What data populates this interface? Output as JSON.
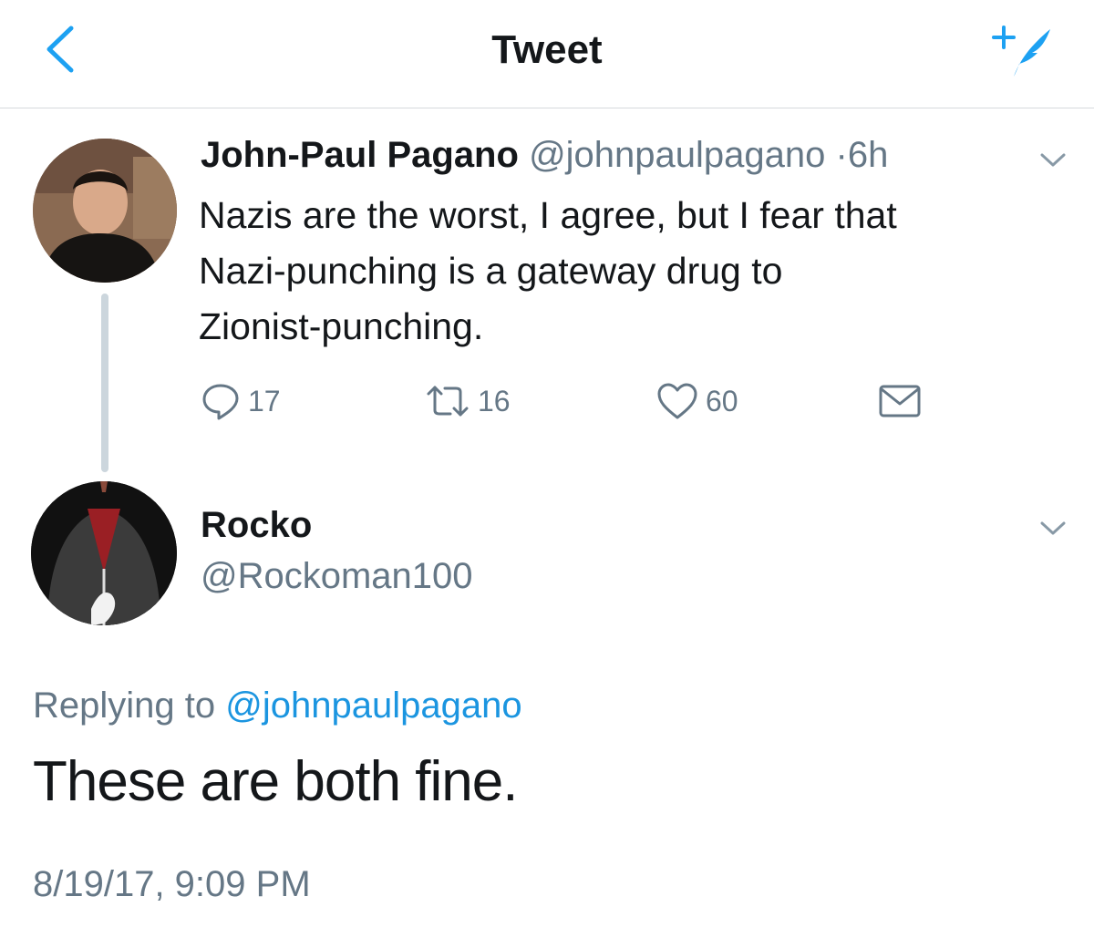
{
  "nav": {
    "title": "Tweet",
    "back_icon": "chevron-left-icon",
    "compose_icon": "compose-tweet-icon",
    "accent": "#1da1f2"
  },
  "parent_tweet": {
    "author_name": "John-Paul Pagano",
    "handle": "@johnpaulpagano",
    "separator": "·",
    "time_ago": "6h",
    "text_lines": [
      "Nazis are the worst, I agree, but I fear that",
      "Nazi-punching is a gateway drug to",
      "Zionist-punching."
    ],
    "actions": {
      "replies": "17",
      "retweets": "16",
      "likes": "60"
    }
  },
  "reply_tweet": {
    "author_name": "Rocko",
    "handle": "@Rockoman100",
    "replying_prefix": "Replying to",
    "replying_mention": "@johnpaulpagano",
    "text": "These are both fine.",
    "timestamp": "8/19/17, 9:09 PM"
  },
  "colors": {
    "text": "#14171a",
    "secondary": "#657786",
    "link": "#1b95e0",
    "divider": "#d6d9dc",
    "thread_line": "#ccd6dd"
  }
}
